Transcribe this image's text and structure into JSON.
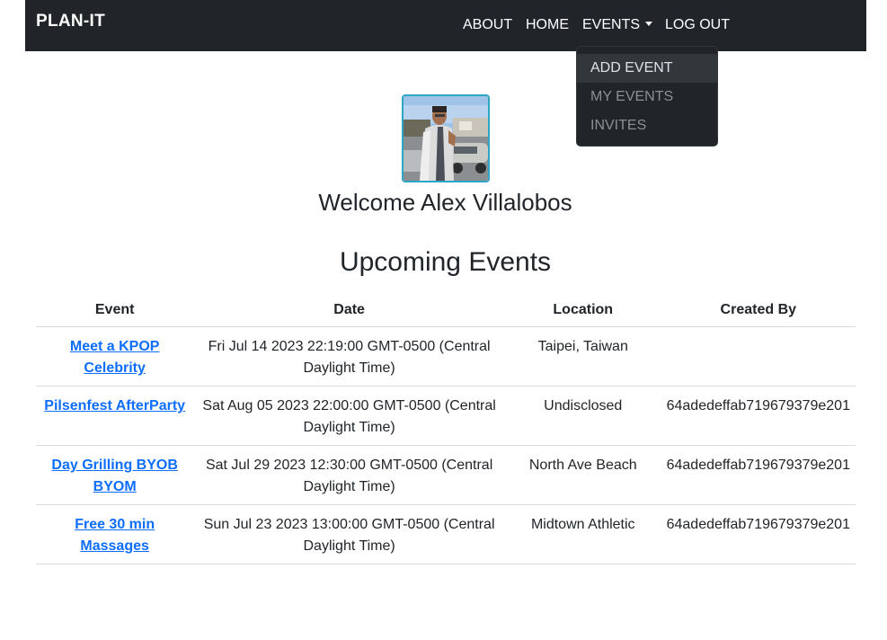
{
  "navbar": {
    "brand": "PLAN-IT",
    "links": {
      "about": "ABOUT",
      "home": "HOME",
      "events": "EVENTS",
      "logout": "LOG OUT"
    }
  },
  "events_menu": {
    "items": [
      "ADD EVENT",
      "MY EVENTS",
      "INVITES"
    ],
    "highlighted": "ADD EVENT"
  },
  "profile": {
    "welcome": "Welcome Alex Villalobos"
  },
  "section_title": "Upcoming Events",
  "table": {
    "headers": [
      "Event",
      "Date",
      "Location",
      "Created By"
    ],
    "rows": [
      {
        "event": "Meet a KPOP Celebrity",
        "date": "Fri Jul 14 2023 22:19:00 GMT-0500 (Central Daylight Time)",
        "location": "Taipei, Taiwan",
        "created_by": ""
      },
      {
        "event": "Pilsenfest AfterParty",
        "date": "Sat Aug 05 2023 22:00:00 GMT-0500 (Central Daylight Time)",
        "location": "Undisclosed",
        "created_by": "64adedeffab719679379e201"
      },
      {
        "event": "Day Grilling BYOB BYOM",
        "date": "Sat Jul 29 2023 12:30:00 GMT-0500 (Central Daylight Time)",
        "location": "North Ave Beach",
        "created_by": "64adedeffab719679379e201"
      },
      {
        "event": "Free 30 min Massages",
        "date": "Sun Jul 23 2023 13:00:00 GMT-0500 (Central Daylight Time)",
        "location": "Midtown Athletic",
        "created_by": "64adedeffab719679379e201"
      }
    ]
  },
  "colors": {
    "navbar_bg": "#212529",
    "link_blue": "#0d6efd",
    "avatar_border": "#2ea7c7"
  }
}
